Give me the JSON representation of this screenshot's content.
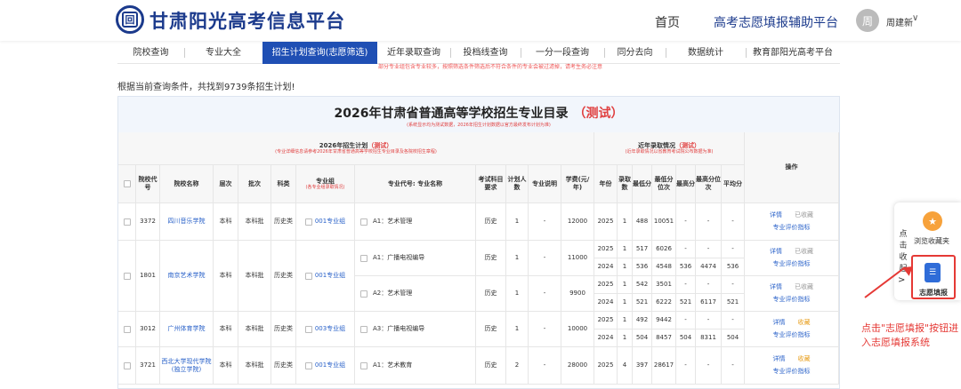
{
  "header": {
    "logo_glyph": "回",
    "site_title": "甘肃阳光高考信息平台",
    "nav": {
      "home": "首页",
      "assist": "高考志愿填报辅助平台"
    },
    "user": {
      "avatar_text": "周",
      "name": "周建新",
      "caret": "∨"
    }
  },
  "menu": {
    "items": [
      "院校查询",
      "专业大全",
      "招生计划查询(志愿筛选)",
      "近年录取查询",
      "投档线查询",
      "一分一段查询",
      "同分去向",
      "数据统计",
      "教育部阳光高考平台"
    ],
    "active_index": 2
  },
  "notice": "部分专业组包含专业较多，按照筛选条件筛选后不符合条件的专业会被过滤掉，请考生务必注意",
  "result_text": "根据当前查询条件，共找到9739条招生计划!",
  "panel": {
    "title": "2026年甘肃省普通高等学校招生专业目录",
    "title_tag": "（测试）",
    "subtitle": "(系统显示均为测试数据，2026年招生计划数据以官方最终发布计划为准)"
  },
  "table": {
    "plan_group": {
      "title": "2026年招生计划",
      "tag": "（测试）",
      "note": "(专业详细信息请参考2026年甘肃省普通高等学校招生专业目录及各院校招生章程)"
    },
    "history_group": {
      "title": "近年录取情况",
      "tag": "（测试）",
      "note": "(近年录取情况以省教育考试院公布数据为准)"
    },
    "headers": {
      "school_code": "院校代号",
      "school_name": "院校名称",
      "level": "层次",
      "batch": "批次",
      "subject": "科类",
      "group": "专业组",
      "group_note": "(各专业组录取情况)",
      "major": "专业代号: 专业名称",
      "req": "考试科目要求",
      "plan": "计划人数",
      "desc": "专业说明",
      "fee": "学费(元/年)",
      "year": "年份",
      "admit": "录取数",
      "min_score": "最低分",
      "min_rank": "最低分位次",
      "max_score": "最高分",
      "max_rank": "最高分位次",
      "avg_score": "平均分",
      "op": "操作"
    },
    "schools": [
      {
        "code": "3372",
        "name": "四川音乐学院",
        "level": "本科",
        "batch": "本科批",
        "subject": "历史类",
        "group": "001专业组",
        "majors": [
          {
            "name": "A1：艺术管理",
            "req": "历史",
            "plan": "1",
            "desc": "-",
            "fee": "12000",
            "history": [
              {
                "year": "2025",
                "admit": "1",
                "min": "488",
                "min_rank": "10051",
                "max": "-",
                "max_rank": "-",
                "avg": "-"
              }
            ],
            "ops": {
              "detail": "详情",
              "fav": "已收藏",
              "eval": "专业评价指标"
            }
          }
        ]
      },
      {
        "code": "1801",
        "name": "南京艺术学院",
        "level": "本科",
        "batch": "本科批",
        "subject": "历史类",
        "group": "001专业组",
        "majors": [
          {
            "name": "A1：广播电视编导",
            "req": "历史",
            "plan": "1",
            "desc": "-",
            "fee": "11000",
            "history": [
              {
                "year": "2025",
                "admit": "1",
                "min": "517",
                "min_rank": "6026",
                "max": "-",
                "max_rank": "-",
                "avg": "-"
              },
              {
                "year": "2024",
                "admit": "1",
                "min": "536",
                "min_rank": "4548",
                "max": "536",
                "max_rank": "4474",
                "avg": "536"
              }
            ],
            "ops": {
              "detail": "详情",
              "fav": "已收藏",
              "eval": "专业评价指标"
            }
          },
          {
            "name": "A2：艺术管理",
            "req": "历史",
            "plan": "1",
            "desc": "-",
            "fee": "9900",
            "history": [
              {
                "year": "2025",
                "admit": "1",
                "min": "542",
                "min_rank": "3501",
                "max": "-",
                "max_rank": "-",
                "avg": "-"
              },
              {
                "year": "2024",
                "admit": "1",
                "min": "521",
                "min_rank": "6222",
                "max": "521",
                "max_rank": "6117",
                "avg": "521"
              }
            ],
            "ops": {
              "detail": "详情",
              "fav": "已收藏",
              "eval": "专业评价指标"
            }
          }
        ]
      },
      {
        "code": "3012",
        "name": "广州体育学院",
        "level": "本科",
        "batch": "本科批",
        "subject": "历史类",
        "group": "003专业组",
        "majors": [
          {
            "name": "A3：广播电视编导",
            "req": "历史",
            "plan": "1",
            "desc": "-",
            "fee": "10000",
            "history": [
              {
                "year": "2025",
                "admit": "1",
                "min": "492",
                "min_rank": "9442",
                "max": "-",
                "max_rank": "-",
                "avg": "-"
              },
              {
                "year": "2024",
                "admit": "1",
                "min": "504",
                "min_rank": "8457",
                "max": "504",
                "max_rank": "8311",
                "avg": "504"
              }
            ],
            "ops": {
              "detail": "详情",
              "fav": "收藏",
              "eval": "专业评价指标"
            }
          }
        ]
      },
      {
        "code": "3721",
        "name": "西北大学现代学院(独立学院)",
        "level": "本科",
        "batch": "本科批",
        "subject": "历史类",
        "group": "001专业组",
        "majors": [
          {
            "name": "A1：艺术教育",
            "req": "历史",
            "plan": "2",
            "desc": "-",
            "fee": "28000",
            "history": [
              {
                "year": "2025",
                "admit": "4",
                "min": "397",
                "min_rank": "28617",
                "max": "-",
                "max_rank": "-",
                "avg": "-"
              }
            ],
            "ops": {
              "detail": "详情",
              "fav": "收藏",
              "eval": "专业评价指标"
            }
          }
        ]
      }
    ]
  },
  "sidebar": {
    "collapse_text": "点击收起",
    "arrow": ">",
    "fav_label": "浏览收藏夹",
    "apply_label": "志愿填报"
  },
  "annotation": "点击\"志愿填报\"按钮进入志愿填报系统",
  "colors": {
    "brand": "#1b3a8c",
    "active_tab": "#1f4fb4",
    "accent_red": "#e04040",
    "link": "#2a62c9"
  }
}
